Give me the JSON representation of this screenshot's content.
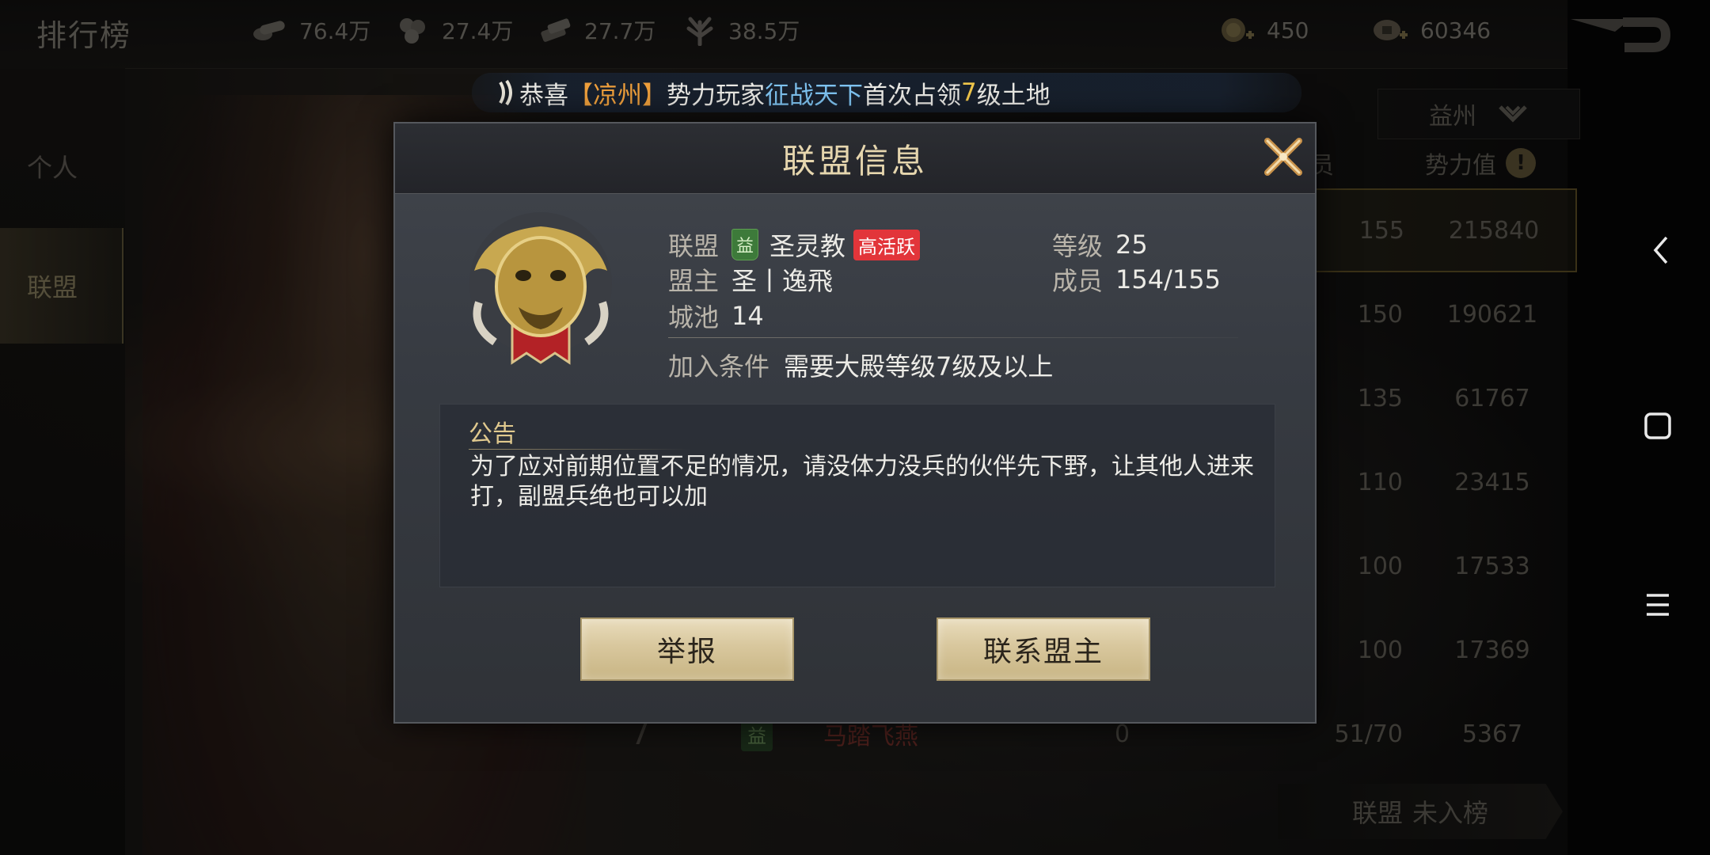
{
  "page_title": "排行榜",
  "resources": [
    {
      "icon": "wood-icon",
      "value": "76.4万"
    },
    {
      "icon": "iron-icon",
      "value": "27.4万"
    },
    {
      "icon": "stone-icon",
      "value": "27.7万"
    },
    {
      "icon": "grain-icon",
      "value": "38.5万"
    },
    {
      "icon": "gold-coin-icon",
      "value": "450"
    },
    {
      "icon": "copper-coin-icon",
      "value": "60346"
    }
  ],
  "tabs": {
    "personal": "个人",
    "alliance": "联盟"
  },
  "ticker": {
    "prefix": "恭喜",
    "region": "【凉州】",
    "middle": "势力玩家",
    "player": "征战天下",
    "action": "首次占领",
    "level": "7",
    "suffix": "级土地"
  },
  "ranking": {
    "region_select": "益州",
    "header_members": "员",
    "header_power": "势力值",
    "info_mark": "!",
    "rows": [
      {
        "rank": "",
        "tag": "",
        "name": "",
        "zero": "",
        "members": "155",
        "power": "215840"
      },
      {
        "rank": "",
        "tag": "",
        "name": "",
        "zero": "",
        "members": "150",
        "power": "190621"
      },
      {
        "rank": "",
        "tag": "",
        "name": "",
        "zero": "",
        "members": "135",
        "power": "61767"
      },
      {
        "rank": "",
        "tag": "",
        "name": "",
        "zero": "",
        "members": "110",
        "power": "23415"
      },
      {
        "rank": "",
        "tag": "",
        "name": "",
        "zero": "",
        "members": "100",
        "power": "17533"
      },
      {
        "rank": "",
        "tag": "",
        "name": "",
        "zero": "",
        "members": "100",
        "power": "17369"
      },
      {
        "rank": "7",
        "tag": "益",
        "name": "马踏飞燕",
        "zero": "0",
        "members": "51/70",
        "power": "5367"
      }
    ],
    "my_rank_label": "联盟",
    "my_rank_value": "未入榜"
  },
  "modal": {
    "title": "联盟信息",
    "alliance_label": "联盟",
    "alliance_tag": "益",
    "alliance_name": "圣灵教",
    "activity_badge": "高活跃",
    "leader_label": "盟主",
    "leader_name": "圣丨逸飛",
    "cities_label": "城池",
    "cities_value": "14",
    "level_label": "等级",
    "level_value": "25",
    "members_label": "成员",
    "members_value": "154/155",
    "join_label": "加入条件",
    "join_value": "需要大殿等级7级及以上",
    "notice_title": "公告",
    "notice_text": "为了应对前期位置不足的情况，请没体力没兵的伙伴先下野，让其他人进来打，副盟兵绝也可以加",
    "report_button": "举报",
    "contact_button": "联系盟主"
  },
  "colors": {
    "accent_gold": "#e6d6ae",
    "button_gold": "#d8c79d",
    "active_red": "#e2353a",
    "region_orange": "#f0a03c",
    "player_blue": "#7fc4f2",
    "tag_green": "#3d7a3a"
  }
}
